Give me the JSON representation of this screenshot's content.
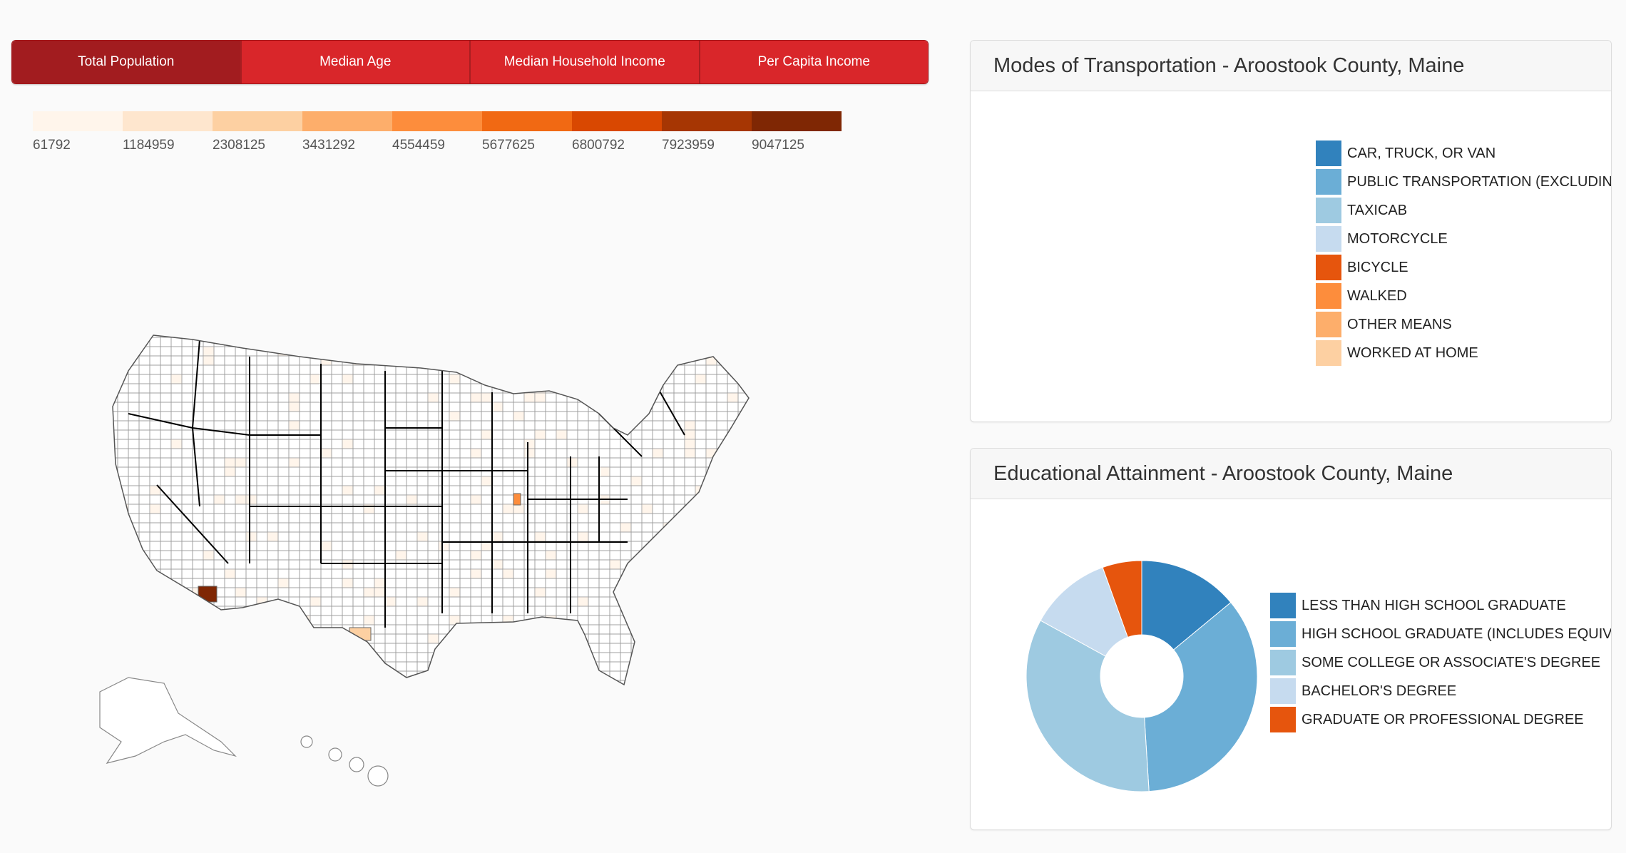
{
  "tabs": [
    {
      "label": "Total Population",
      "active": true
    },
    {
      "label": "Median Age",
      "active": false
    },
    {
      "label": "Median Household Income",
      "active": false
    },
    {
      "label": "Per Capita Income",
      "active": false
    }
  ],
  "scale": {
    "colors": [
      "#fff5eb",
      "#fee6ce",
      "#fdd0a2",
      "#fdae6b",
      "#fd8d3c",
      "#f16913",
      "#d94801",
      "#a63603",
      "#7f2704"
    ],
    "labels": [
      "61792",
      "1184959",
      "2308125",
      "3431292",
      "4554459",
      "5677625",
      "6800792",
      "7923959",
      "9047125"
    ]
  },
  "map": {
    "region": "United States counties",
    "highlight_colors": {
      "max": "#7f2704",
      "high": "#fd8d3c",
      "mid": "#fdd0a2",
      "low": "#fff5eb"
    }
  },
  "transport": {
    "title": "Modes of Transportation - Aroostook County, Maine",
    "legend": [
      {
        "label": "CAR, TRUCK, OR VAN",
        "color": "#3182bd"
      },
      {
        "label": "PUBLIC TRANSPORTATION (EXCLUDING TA",
        "color": "#6baed6"
      },
      {
        "label": "TAXICAB",
        "color": "#9ecae1"
      },
      {
        "label": "MOTORCYCLE",
        "color": "#c6dbef"
      },
      {
        "label": "BICYCLE",
        "color": "#e6550d"
      },
      {
        "label": "WALKED",
        "color": "#fd8d3c"
      },
      {
        "label": "OTHER MEANS",
        "color": "#fdae6b"
      },
      {
        "label": "WORKED AT HOME",
        "color": "#fdd0a2"
      }
    ]
  },
  "education": {
    "title": "Educational Attainment - Aroostook County, Maine",
    "legend": [
      {
        "label": "LESS THAN HIGH SCHOOL GRADUATE",
        "color": "#3182bd"
      },
      {
        "label": "HIGH SCHOOL GRADUATE (INCLUDES EQUIVALEN",
        "color": "#6baed6"
      },
      {
        "label": "SOME COLLEGE OR ASSOCIATE'S DEGREE",
        "color": "#9ecae1"
      },
      {
        "label": "BACHELOR'S DEGREE",
        "color": "#c6dbef"
      },
      {
        "label": "GRADUATE OR PROFESSIONAL DEGREE",
        "color": "#e6550d"
      }
    ],
    "chart_data": {
      "type": "pie",
      "categories": [
        "LESS THAN HIGH SCHOOL GRADUATE",
        "HIGH SCHOOL GRADUATE (INCLUDES EQUIVALEN",
        "SOME COLLEGE OR ASSOCIATE'S DEGREE",
        "BACHELOR'S DEGREE",
        "GRADUATE OR PROFESSIONAL DEGREE"
      ],
      "values": [
        14,
        35,
        34,
        11.5,
        5.5
      ],
      "colors": [
        "#3182bd",
        "#6baed6",
        "#9ecae1",
        "#c6dbef",
        "#e6550d"
      ],
      "donut": true
    }
  }
}
